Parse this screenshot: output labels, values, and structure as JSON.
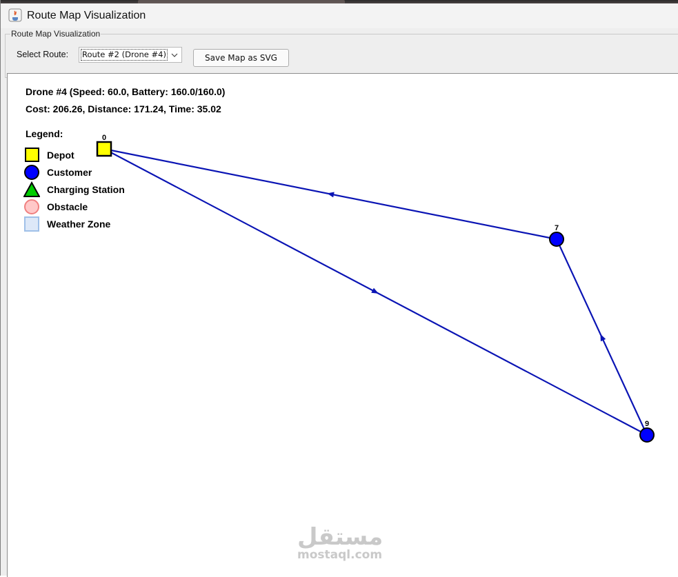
{
  "window": {
    "title": "Route Map Visualization"
  },
  "controls": {
    "group_title": "Route Map Visualization",
    "select_label": "Select Route:",
    "selected_route": "Route #2 (Drone #4)",
    "save_button": "Save Map as SVG"
  },
  "info": {
    "drone_line": "Drone #4 (Speed: 60.0, Battery: 160.0/160.0)",
    "stats_line": "Cost: 206.26, Distance: 171.24, Time: 35.02"
  },
  "legend": {
    "title": "Legend:",
    "items": [
      {
        "label": "Depot",
        "symbol": "square",
        "fill": "#ffff00",
        "stroke": "#000000"
      },
      {
        "label": "Customer",
        "symbol": "circle",
        "fill": "#0000ff",
        "stroke": "#000000"
      },
      {
        "label": "Charging Station",
        "symbol": "triangle",
        "fill": "#00cc00",
        "stroke": "#000000"
      },
      {
        "label": "Obstacle",
        "symbol": "circle",
        "fill": "#ffc8c8",
        "stroke": "#f08080"
      },
      {
        "label": "Weather Zone",
        "symbol": "square",
        "fill": "#dde8f8",
        "stroke": "#9fc0e8"
      }
    ]
  },
  "route": {
    "color": "#0a14b4",
    "nodes": [
      {
        "id": "0",
        "type": "depot"
      },
      {
        "id": "7",
        "type": "customer"
      },
      {
        "id": "9",
        "type": "customer"
      }
    ],
    "path": [
      "0",
      "9",
      "7",
      "0"
    ]
  },
  "watermark": {
    "arabic": "مستقل",
    "latin": "mostaql.com"
  }
}
